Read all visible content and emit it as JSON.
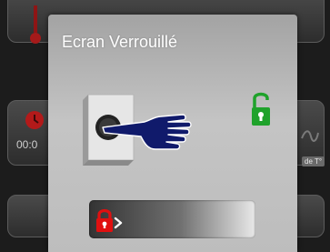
{
  "dialog": {
    "title": "Ecran Verrouillé",
    "state_icon": "open-padlock-icon",
    "slider_icon": "locked-padlock-arrow-icon"
  },
  "background": {
    "timer_text": "00:0",
    "mode_text": "de T°"
  },
  "colors": {
    "lock_green": "#1fa22b",
    "lock_red": "#e01010",
    "hand_blue": "#101a6b",
    "alarm_red": "#b31a1a"
  }
}
